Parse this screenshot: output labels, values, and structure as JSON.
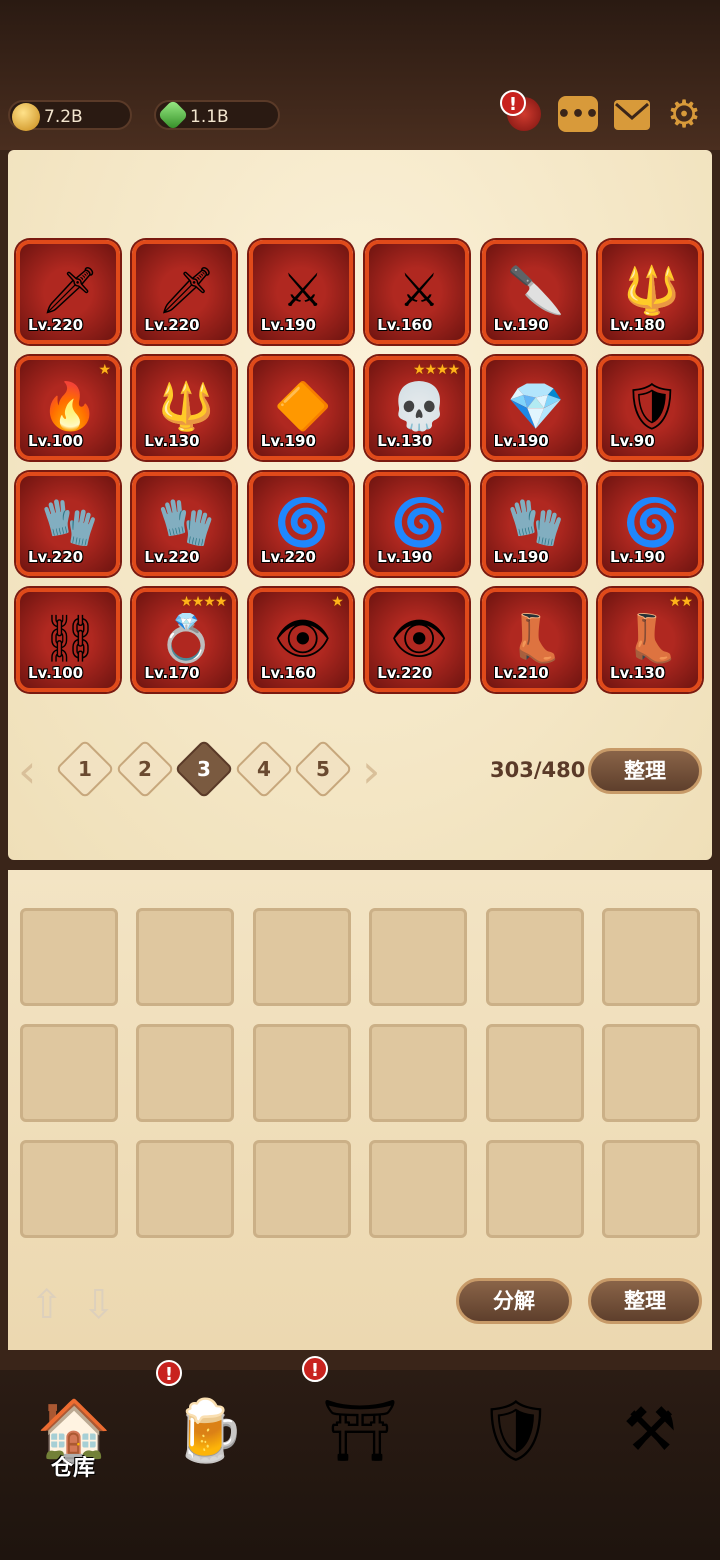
{
  "currency": {
    "gold": "7.2B",
    "gems": "1.1B"
  },
  "header_icons": [
    "shop-alert-icon",
    "chat-icon",
    "mail-icon",
    "gear-icon"
  ],
  "items": [
    {
      "icon": "blade-icon",
      "lv": "Lv.220"
    },
    {
      "icon": "scimitar-icon",
      "lv": "Lv.220"
    },
    {
      "icon": "ice-sword-icon",
      "lv": "Lv.190"
    },
    {
      "icon": "ice-sword-icon",
      "lv": "Lv.160"
    },
    {
      "icon": "bone-dagger-icon",
      "lv": "Lv.190"
    },
    {
      "icon": "golden-dagger-icon",
      "lv": "Lv.180"
    },
    {
      "icon": "flame-sword-icon",
      "lv": "Lv.100",
      "stars": "★"
    },
    {
      "icon": "golden-dagger-icon",
      "lv": "Lv.130"
    },
    {
      "icon": "amber-amulet-icon",
      "lv": "Lv.190"
    },
    {
      "icon": "skull-helm-icon",
      "lv": "Lv.130",
      "stars": "★★★★"
    },
    {
      "icon": "emerald-amulet-icon",
      "lv": "Lv.190"
    },
    {
      "icon": "dark-armor-icon",
      "lv": "Lv.90"
    },
    {
      "icon": "golden-gauntlet-icon",
      "lv": "Lv.220"
    },
    {
      "icon": "golden-gauntlet-icon",
      "lv": "Lv.220"
    },
    {
      "icon": "vortex-gauntlet-icon",
      "lv": "Lv.220"
    },
    {
      "icon": "vortex-gauntlet-icon",
      "lv": "Lv.190"
    },
    {
      "icon": "gilded-gauntlet-icon",
      "lv": "Lv.190"
    },
    {
      "icon": "vortex-gauntlet-icon",
      "lv": "Lv.190"
    },
    {
      "icon": "chain-gauntlet-icon",
      "lv": "Lv.100"
    },
    {
      "icon": "sapphire-ring-icon",
      "lv": "Lv.170",
      "stars": "★★★★"
    },
    {
      "icon": "dragon-eye-ring-icon",
      "lv": "Lv.160",
      "stars": "★"
    },
    {
      "icon": "dragon-eye-ring-icon",
      "lv": "Lv.220"
    },
    {
      "icon": "crystal-boots-icon",
      "lv": "Lv.210"
    },
    {
      "icon": "crystal-boots-icon",
      "lv": "Lv.130",
      "stars": "★★"
    }
  ],
  "pagination": {
    "pages": [
      "1",
      "2",
      "3",
      "4",
      "5"
    ],
    "current": "3"
  },
  "capacity": "303/480",
  "sort_label": "整理",
  "decompose_label": "分解",
  "sort_label_lower": "整理",
  "nav": [
    {
      "icon": "warehouse-icon",
      "label": "仓库",
      "active": true
    },
    {
      "icon": "tavern-icon",
      "alert": true
    },
    {
      "icon": "portal-icon",
      "alert": true
    },
    {
      "icon": "treasure-icon"
    },
    {
      "icon": "forge-icon"
    }
  ]
}
